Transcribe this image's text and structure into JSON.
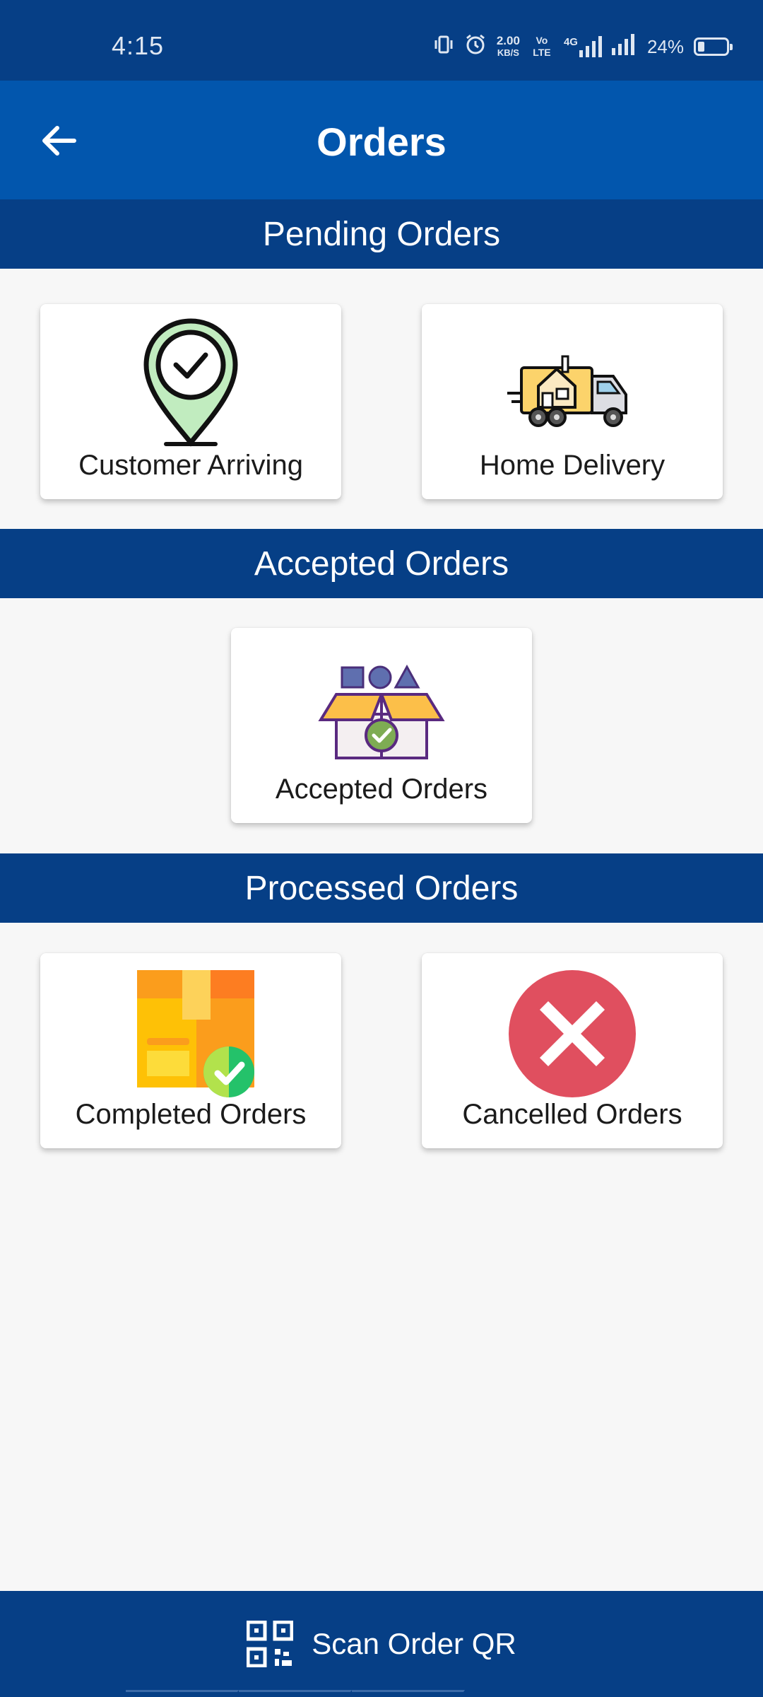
{
  "status_bar": {
    "time": "4:15",
    "network_speed": "2.00",
    "network_speed_unit": "KB/S",
    "volte": "Vo LTE",
    "network_type": "4G",
    "battery_percent": "24%",
    "battery_level": 0.24
  },
  "app_bar": {
    "title": "Orders",
    "back_icon": "arrow-left-icon"
  },
  "sections": {
    "pending": {
      "title": "Pending Orders",
      "cards": [
        {
          "label": "Customer Arriving",
          "icon": "location-check-icon"
        },
        {
          "label": "Home Delivery",
          "icon": "delivery-truck-icon"
        }
      ]
    },
    "accepted": {
      "title": "Accepted Orders",
      "cards": [
        {
          "label": "Accepted Orders",
          "icon": "open-box-check-icon"
        }
      ]
    },
    "processed": {
      "title": "Processed Orders",
      "cards": [
        {
          "label": "Completed Orders",
          "icon": "package-check-icon"
        },
        {
          "label": "Cancelled Orders",
          "icon": "cancel-circle-icon"
        }
      ]
    }
  },
  "bottom_bar": {
    "label": "Scan Order QR",
    "icon": "qr-code-icon"
  },
  "colors": {
    "primary_dark": "#063f86",
    "primary": "#0256ad",
    "background": "#f7f7f7",
    "card": "#ffffff",
    "cancel_red": "#e04f5f"
  }
}
